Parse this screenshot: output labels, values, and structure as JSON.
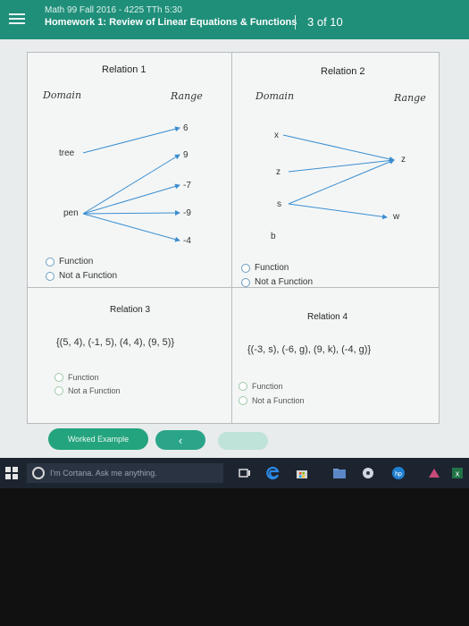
{
  "header": {
    "course": "Math 99 Fall 2016 - 4225 TTh 5:30",
    "assignment": "Homework 1: Review of Linear Equations & Functions",
    "progress": "3 of 10"
  },
  "relations": [
    {
      "title": "Relation 1",
      "domain_header": "Domain",
      "range_header": "Range",
      "domain": [
        "tree",
        "pen"
      ],
      "range": [
        "6",
        "9",
        "-7",
        "-9",
        "-4"
      ],
      "options": [
        "Function",
        "Not a Function"
      ]
    },
    {
      "title": "Relation 2",
      "domain_header": "Domain",
      "range_header": "Range",
      "domain": [
        "x",
        "z",
        "s",
        "b"
      ],
      "range": [
        "z",
        "w"
      ],
      "options": [
        "Function",
        "Not a Function"
      ]
    },
    {
      "title": "Relation 3",
      "set": "{(5, 4), (-1, 5), (4, 4), (9, 5)}",
      "options": [
        "Function",
        "Not a Function"
      ]
    },
    {
      "title": "Relation 4",
      "set": "{(-3, s), (-6, g), (9, k), (-4, g)}",
      "options": [
        "Function",
        "Not a Function"
      ]
    }
  ],
  "actions": {
    "worked_example": "Worked Example",
    "back_glyph": "‹"
  },
  "taskbar": {
    "search_placeholder": "I'm Cortana. Ask me anything."
  },
  "colors": {
    "header_bg": "#1f8f7a",
    "arrow": "#3b8ed0",
    "button": "#24a47e"
  }
}
